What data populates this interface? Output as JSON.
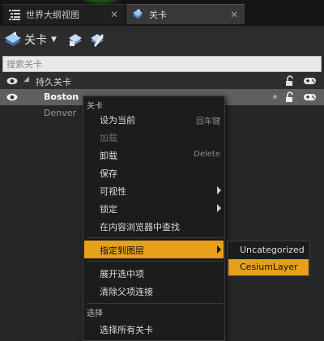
{
  "tabs": [
    {
      "label": "世界大纲视图",
      "icon": "outliner-list-icon"
    },
    {
      "label": "关卡",
      "icon": "levels-icon"
    }
  ],
  "toolbar": {
    "levels_label": "关卡"
  },
  "search": {
    "placeholder": "搜索关卡"
  },
  "levels": [
    {
      "label": "持久关卡"
    },
    {
      "label": "Boston"
    },
    {
      "label": "Denver"
    }
  ],
  "menu": {
    "header": "关卡",
    "items": [
      {
        "label": "设为当前",
        "shortcut": "回车键"
      },
      {
        "label": "加载"
      },
      {
        "label": "卸载",
        "shortcut": "Delete"
      },
      {
        "label": "保存"
      },
      {
        "label": "可视性"
      },
      {
        "label": "锁定"
      },
      {
        "label": "在内容浏览器中查找"
      },
      {
        "label": "指定到图层"
      },
      {
        "label": "展开选中项"
      },
      {
        "label": "清除父项连接"
      }
    ],
    "section_select": "选择",
    "select_all": "选择所有关卡"
  },
  "submenu": {
    "items": [
      "Uncategorized",
      "CesiumLayer"
    ]
  },
  "colors": {
    "highlight": "#e6a01a",
    "selected_row": "#5f5f5f",
    "background": "#262626"
  }
}
